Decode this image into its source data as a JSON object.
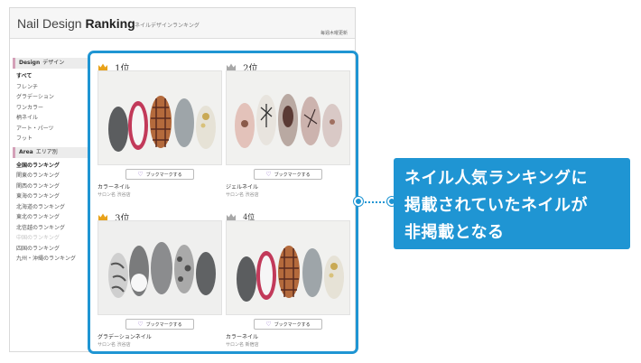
{
  "header": {
    "logo_light": "Nail Design",
    "logo_bold": "Ranking",
    "subtitle": "ネイルデザインランキング",
    "update_note": "毎週木曜更新"
  },
  "sidebar": {
    "design_head": {
      "en": "Design",
      "jp": "デザイン"
    },
    "design_items": [
      "すべて",
      "フレンチ",
      "グラデーション",
      "ワンカラー",
      "柄ネイル",
      "アート・パーツ",
      "フット"
    ],
    "area_head": {
      "en": "Area",
      "jp": "エリア別"
    },
    "area_items": [
      "全国のランキング",
      "関東のランキング",
      "関西のランキング",
      "東海のランキング",
      "北海道のランキング",
      "東北のランキング",
      "北信越のランキング",
      "中国のランキング",
      "四国のランキング",
      "九州・沖縄のランキング"
    ]
  },
  "cards": [
    {
      "rank": "1位",
      "crown": "gold",
      "bookmark_label": "ブックマークする",
      "title": "カラーネイル",
      "salon": "サロン名 渋谷店"
    },
    {
      "rank": "2位",
      "crown": "silver",
      "bookmark_label": "ブックマークする",
      "title": "ジェルネイル",
      "salon": "サロン名 渋谷店"
    },
    {
      "rank": "3位",
      "crown": "gold",
      "bookmark_label": "ブックマークする",
      "title": "グラデーションネイル",
      "salon": "サロン名 渋谷店"
    },
    {
      "rank": "4位",
      "crown": "silver",
      "bookmark_label": "ブックマークする",
      "title": "カラーネイル",
      "salon": "サロン名 新宿店"
    }
  ],
  "callout": {
    "lines": [
      "ネイル人気ランキングに",
      "掲載されていたネイルが",
      "非掲載となる"
    ]
  },
  "colors": {
    "accent_blue": "#1f95d3",
    "gold_crown": "#e8a21a",
    "silver_crown": "#a8a8a8",
    "bookmark_heart": "#8a63c8"
  }
}
